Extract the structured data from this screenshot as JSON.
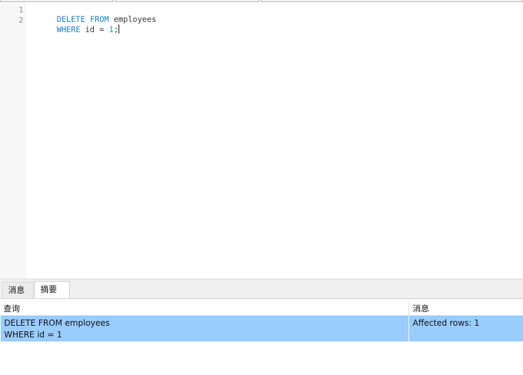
{
  "editor": {
    "lines": [
      {
        "number": "1",
        "tokens": [
          {
            "text": "DELETE",
            "kind": "kw"
          },
          {
            "text": " ",
            "kind": "plain"
          },
          {
            "text": "FROM",
            "kind": "kw"
          },
          {
            "text": " employees",
            "kind": "ident"
          }
        ]
      },
      {
        "number": "2",
        "tokens": [
          {
            "text": "WHERE",
            "kind": "kw"
          },
          {
            "text": " id ",
            "kind": "ident"
          },
          {
            "text": "=",
            "kind": "ident"
          },
          {
            "text": " ",
            "kind": "plain"
          },
          {
            "text": "1",
            "kind": "num"
          },
          {
            "text": ";",
            "kind": "ident"
          }
        ]
      }
    ]
  },
  "result_tabs": [
    {
      "label": "消息",
      "active": false
    },
    {
      "label": "摘要",
      "active": true
    }
  ],
  "summary": {
    "columns": [
      "查询",
      "消息"
    ],
    "rows": [
      {
        "query": "DELETE FROM employees\nWHERE id = 1",
        "message": "Affected rows: 1"
      }
    ]
  },
  "colors": {
    "keyword": "#1a7fd6",
    "number": "#1aa3b8",
    "selected_row": "#99ccff"
  }
}
